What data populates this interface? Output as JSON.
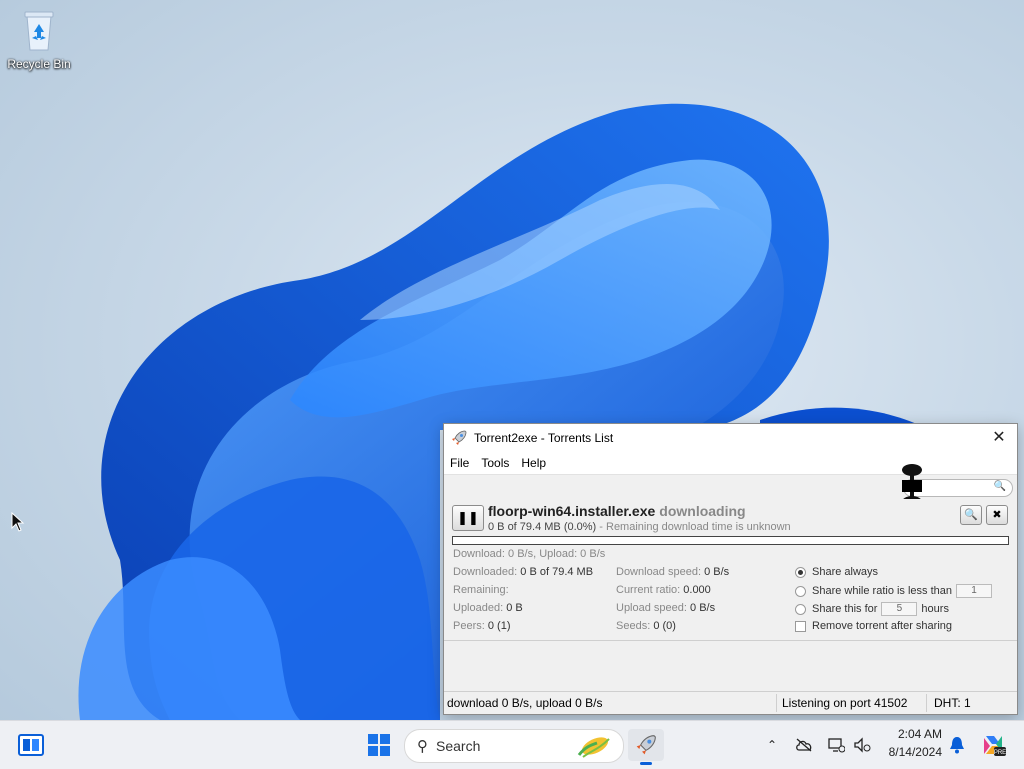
{
  "desktop": {
    "recycle_bin_label": "Recycle Bin"
  },
  "window": {
    "title": "Torrent2exe - Torrents List",
    "menu": [
      "File",
      "Tools",
      "Help"
    ],
    "torrent": {
      "name": "floorp-win64.installer.exe",
      "state": "downloading",
      "size_line": "0 B of 79.4 MB (0.0%)",
      "remaining_line": "- Remaining download time is unknown",
      "progress_fraction": 0.0,
      "summary": "Download: 0 B/s, Upload: 0 B/s",
      "stats": {
        "downloaded_label": "Downloaded:",
        "downloaded_value": "0 B of 79.4 MB",
        "remaining_label": "Remaining:",
        "remaining_value": "",
        "uploaded_label": "Uploaded:",
        "uploaded_value": "0 B",
        "peers_label": "Peers:",
        "peers_value": "0 (1)",
        "dl_speed_label": "Download speed:",
        "dl_speed_value": "0 B/s",
        "ratio_label": "Current ratio:",
        "ratio_value": "0.000",
        "ul_speed_label": "Upload speed:",
        "ul_speed_value": "0 B/s",
        "seeds_label": "Seeds:",
        "seeds_value": "0 (0)"
      },
      "options": {
        "share_always": "Share always",
        "share_ratio": "Share while ratio is less than",
        "share_ratio_value": "1",
        "share_for": "Share this for",
        "share_for_value": "5",
        "share_for_unit": "hours",
        "remove_after": "Remove torrent after sharing"
      }
    },
    "statusbar": {
      "speeds": "download 0 B/s, upload 0 B/s",
      "port": "Listening on port 41502",
      "dht": "DHT: 1"
    }
  },
  "taskbar": {
    "search_label": "Search",
    "time": "2:04 AM",
    "date": "8/14/2024"
  },
  "colors": {
    "accent": "#0a5fd8",
    "taskbar_bg": "#eef0f4",
    "progress_fill": "#3a8ee6"
  }
}
